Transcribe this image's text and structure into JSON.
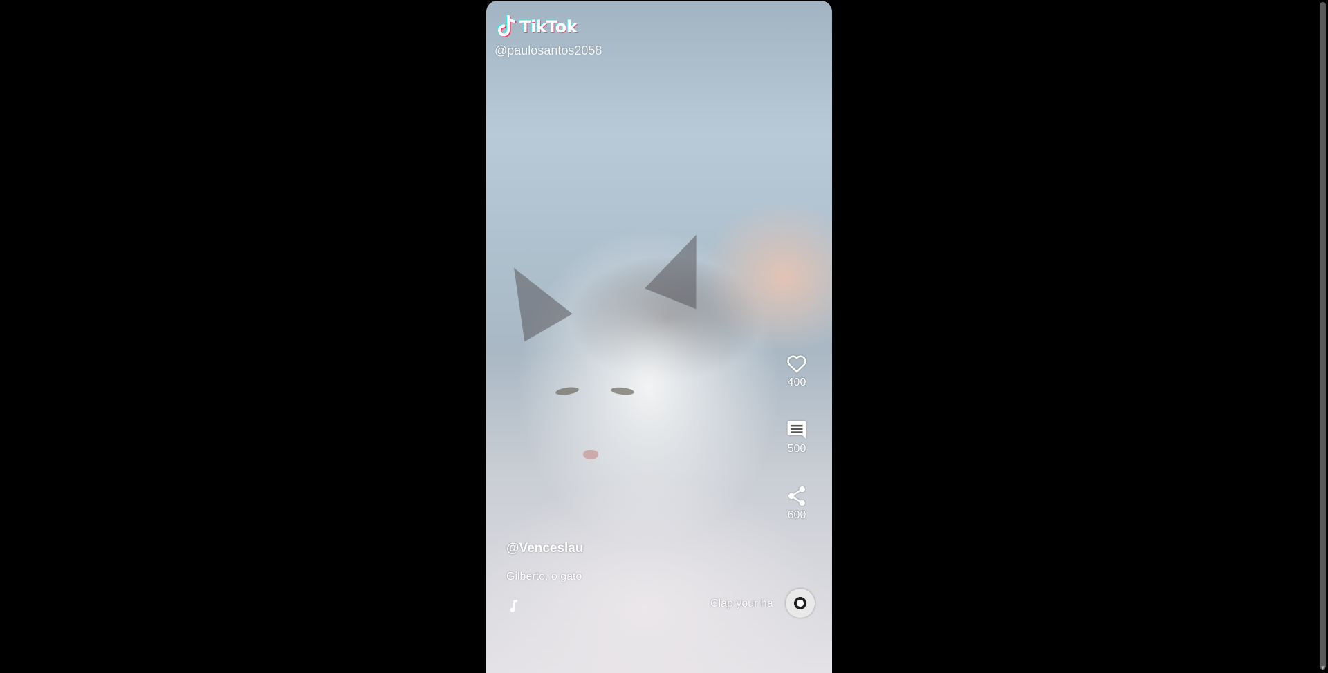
{
  "brand": {
    "name": "TikTok",
    "watermark_handle": "@paulosantos2058",
    "icon": "tiktok-logo-icon",
    "colors": {
      "cyan": "#25f4ee",
      "pink": "#fe2c55"
    }
  },
  "actions": {
    "like": {
      "icon": "heart-icon",
      "count": "400"
    },
    "comment": {
      "icon": "comment-icon",
      "count": "500"
    },
    "share": {
      "icon": "share-icon",
      "count": "600"
    }
  },
  "post": {
    "author": "@Venceslau",
    "caption": "Gilberto, o gato",
    "music_icon": "music-note-icon",
    "sound_title": "Clap your ha",
    "disc_icon": "music-disc-icon"
  }
}
